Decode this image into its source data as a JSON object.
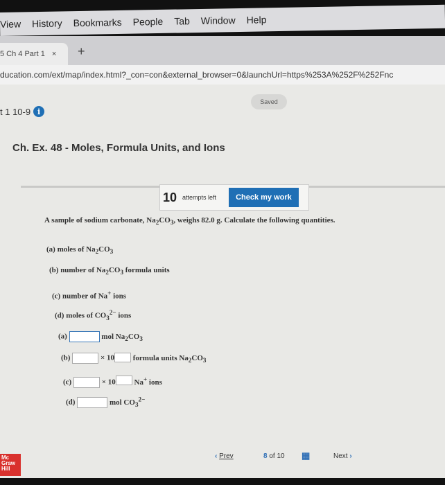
{
  "browser": {
    "menu": [
      "View",
      "History",
      "Bookmarks",
      "People",
      "Tab",
      "Window",
      "Help"
    ],
    "tab_label": "5 Ch 4 Part 1",
    "tab_close": "×",
    "new_tab": "+",
    "url": "ducation.com/ext/map/index.html?_con=con&external_browser=0&launchUrl=https%253A%252F%252Fnc"
  },
  "header": {
    "assignment": "t 1 10-9",
    "info_icon": "i",
    "saved": "Saved"
  },
  "question": {
    "title": "Ch. Ex. 48 - Moles, Formula Units, and Ions",
    "attempts_count": "10",
    "attempts_label": "attempts left",
    "check_button": "Check my work",
    "prompt_html": "A sample of sodium carbonate, Na<sub>2</sub>CO<sub>3</sub>, weighs 82.0 g. Calculate the following quantities.",
    "parts": [
      "(a) moles of Na<sub>2</sub>CO<sub>3</sub>",
      "(b) number of Na<sub>2</sub>CO<sub>3</sub> formula units",
      "(c) number of Na<sup>+</sup> ions",
      "(d) moles of CO<sub>3</sub><sup>2−</sup> ions"
    ],
    "answers": [
      {
        "label": "(a)",
        "unit_html": "mol Na<sub>2</sub>CO<sub>3</sub>",
        "value": ""
      },
      {
        "label": "(b)",
        "times": "× 10",
        "unit_html": "formula units Na<sub>2</sub>CO<sub>3</sub>",
        "value": "",
        "exponent": ""
      },
      {
        "label": "(c)",
        "times": "× 10",
        "unit_html": "Na<sup>+</sup> ions",
        "value": "",
        "exponent": ""
      },
      {
        "label": "(d)",
        "unit_html": "mol CO<sub>3</sub><sup>2−</sup>",
        "value": ""
      }
    ]
  },
  "footer": {
    "logo": "Mc Graw Hill",
    "prev": "Prev",
    "page_current": "8",
    "page_of": "of 10",
    "next": "Next"
  },
  "colors": {
    "accent": "#1f6fb5",
    "logo": "#d9312d"
  }
}
